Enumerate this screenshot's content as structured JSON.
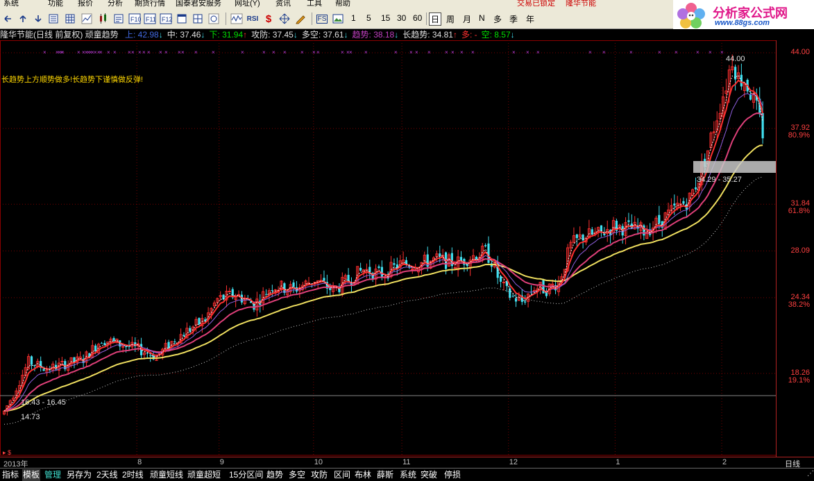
{
  "menu": {
    "items": [
      "系统",
      "功能",
      "报价",
      "分析",
      "期货行情",
      "国泰君安服务",
      "网址(Y)",
      "资讯",
      "工具",
      "帮助"
    ],
    "lock_status": "交易已锁定",
    "stock_name": "隆华节能"
  },
  "toolbar": {
    "periods": [
      "1",
      "5",
      "15",
      "30",
      "60"
    ],
    "cycles": [
      "日",
      "周",
      "月",
      "N",
      "多",
      "季",
      "年"
    ],
    "active_cycle": "日",
    "rsi": "RSI",
    "fs": "FS"
  },
  "logo": {
    "title": "分析家公式网",
    "url": "www.88gs.com"
  },
  "indicator": {
    "title": "隆华节能(日线 前复权) 顽童趋势",
    "items": [
      {
        "label": "上:",
        "value": "42.98",
        "arrow": "↓",
        "color": "#4169E1"
      },
      {
        "label": "中:",
        "value": "37.46",
        "arrow": "↓",
        "color": "#E0E0E0"
      },
      {
        "label": "下:",
        "value": "31.94",
        "arrow": "↑",
        "color": "#00E000"
      },
      {
        "label": "攻防:",
        "value": "37.45",
        "arrow": "↓",
        "color": "#E0E0E0"
      },
      {
        "label": "多空:",
        "value": "37.61",
        "arrow": "↓",
        "color": "#E0E0E0"
      },
      {
        "label": "趋势:",
        "value": "38.18",
        "arrow": "↓",
        "color": "#C040C0"
      },
      {
        "label": "长趋势:",
        "value": "34.81",
        "arrow": "↑",
        "color": "#E0E0E0"
      },
      {
        "label": "多:",
        "value": "-",
        "arrow": "",
        "color": "#FF3030"
      },
      {
        "label": "空:",
        "value": "8.57",
        "arrow": "↓",
        "color": "#00E000"
      }
    ]
  },
  "note": "长趋势上方顺势做多!长趋势下谨慎做反弹!",
  "chart_data": {
    "type": "candlestick",
    "title": "隆华节能(日线 前复权) 顽童趋势",
    "y_ticks": [
      {
        "price": 44.0,
        "label": "44.00",
        "pct": ""
      },
      {
        "price": 37.92,
        "label": "37.92",
        "pct": "80.9%"
      },
      {
        "price": 31.84,
        "label": "31.84",
        "pct": "61.8%"
      },
      {
        "price": 28.09,
        "label": "28.09",
        "pct": ""
      },
      {
        "price": 24.34,
        "label": "24.34",
        "pct": "38.2%"
      },
      {
        "price": 18.26,
        "label": "18.26",
        "pct": "19.1%"
      }
    ],
    "ylim": [
      13.8,
      44.6
    ],
    "x_labels": [
      {
        "label": "2013年",
        "index": 0
      },
      {
        "label": "8",
        "index": 44
      },
      {
        "label": "9",
        "index": 71
      },
      {
        "label": "10",
        "index": 102
      },
      {
        "label": "11",
        "index": 131
      },
      {
        "label": "12",
        "index": 166
      },
      {
        "label": "1",
        "index": 201
      },
      {
        "label": "2",
        "index": 236
      }
    ],
    "annotations": [
      {
        "text": "44.00",
        "index": 248,
        "price": 44.0
      },
      {
        "text": "34.29 - 35.27",
        "index": 238,
        "price": 34.5
      },
      {
        "text": "16.43 - 16.45",
        "index": 6,
        "price": 16.4
      },
      {
        "text": "14.73",
        "index": 6,
        "price": 14.9
      }
    ],
    "ohlc": [],
    "series": [
      {
        "name": "长趋势",
        "color": "#F0E060"
      },
      {
        "name": "趋势",
        "color": "#E0407A"
      },
      {
        "name": "攻防",
        "color": "#FF3030"
      }
    ]
  },
  "timeaxis": {
    "right_label": "日线"
  },
  "tabs": [
    {
      "label": "指标"
    },
    {
      "label": "模板"
    },
    {
      "label": "管理"
    },
    {
      "label": "另存为"
    },
    {
      "label": "2天线"
    },
    {
      "label": "2时线"
    },
    {
      "label": "顽童短线"
    },
    {
      "label": "顽童超短"
    },
    {
      "label": "15分区间"
    },
    {
      "label": "趋势"
    },
    {
      "label": "多空"
    },
    {
      "label": "攻防"
    },
    {
      "label": "区间"
    },
    {
      "label": "布林"
    },
    {
      "label": "薛斯"
    },
    {
      "label": "系统"
    },
    {
      "label": "突破"
    },
    {
      "label": "停损"
    }
  ],
  "colors": {
    "up": "#FF3030",
    "down": "#40E0F0",
    "grid": "#8B0000"
  }
}
